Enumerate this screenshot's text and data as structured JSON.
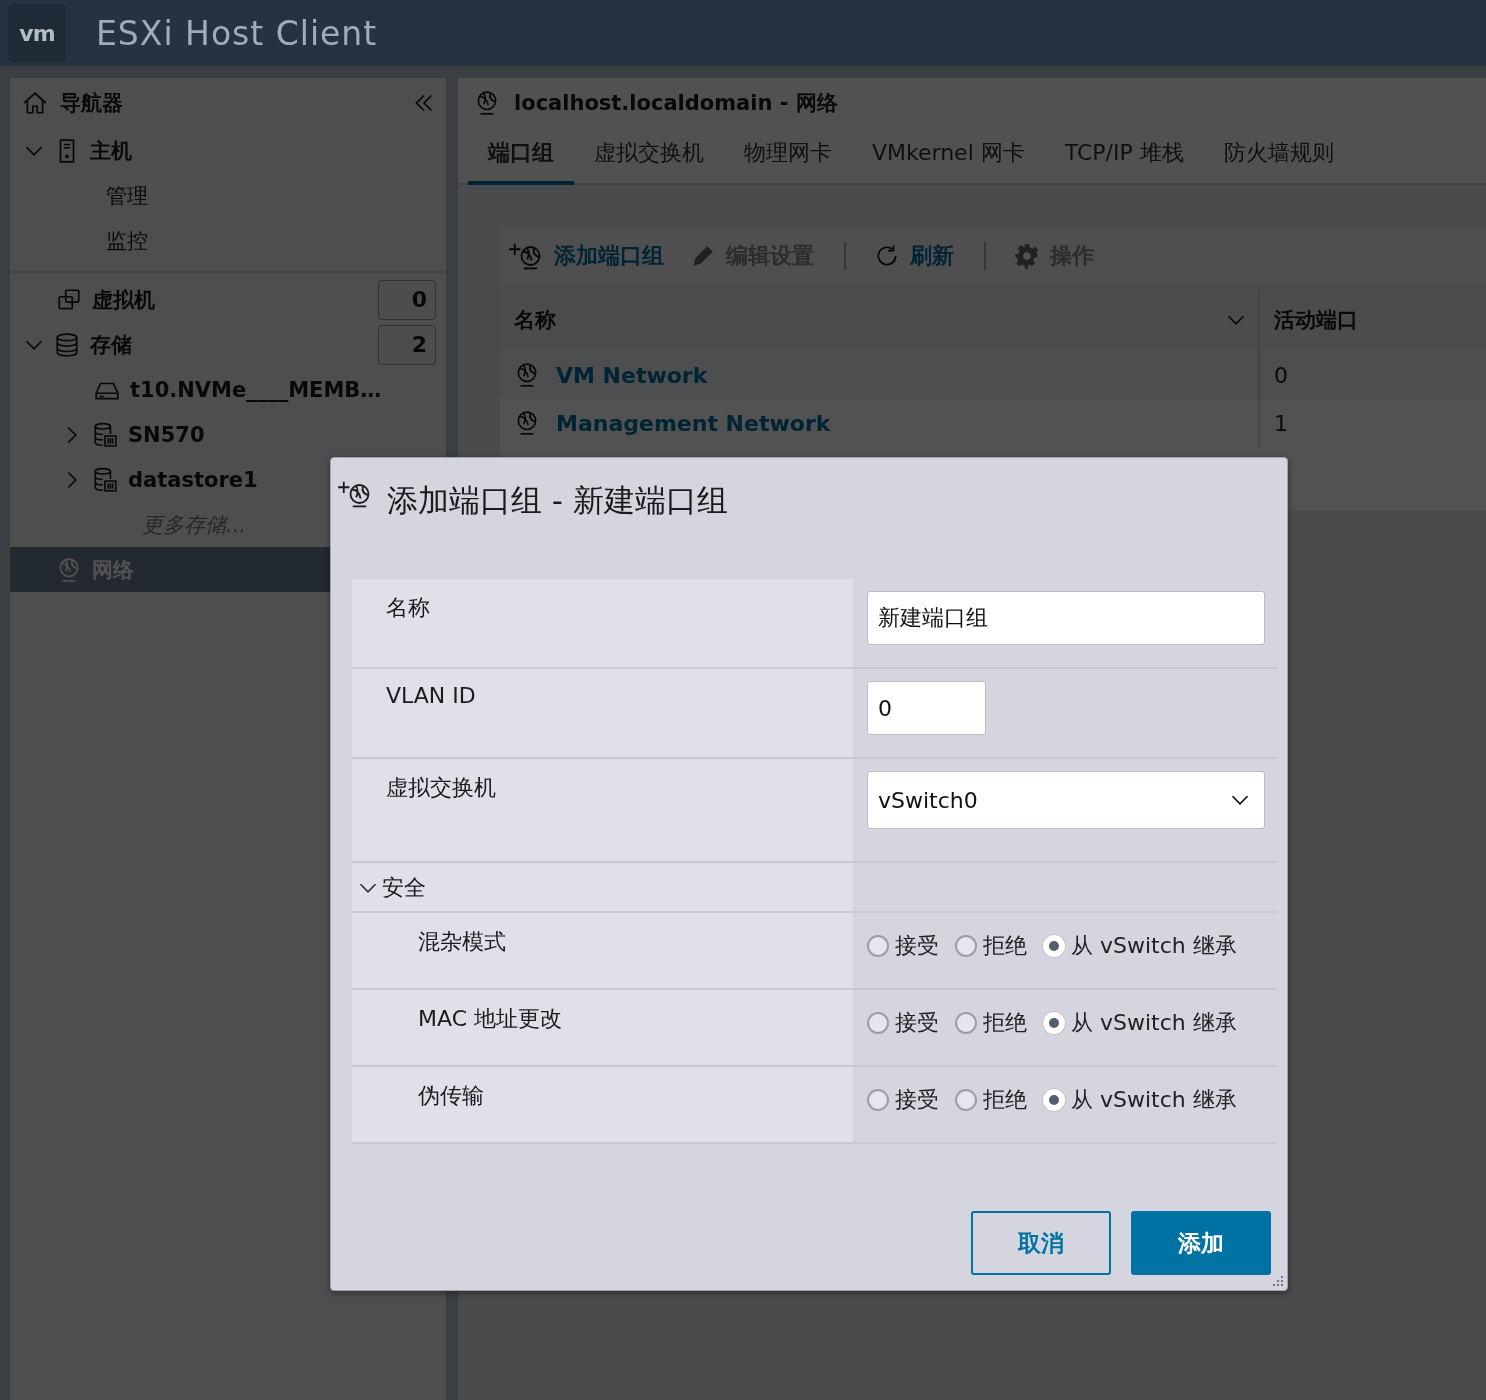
{
  "header": {
    "logo": "vm",
    "title": "ESXi Host Client"
  },
  "navigator": {
    "title": "导航器",
    "items": [
      {
        "label": "主机",
        "kind": "host",
        "expanded": true,
        "selected": false,
        "children": [
          {
            "label": "管理",
            "kind": "page",
            "selected": false
          },
          {
            "label": "监控",
            "kind": "page",
            "selected": false
          }
        ]
      },
      {
        "label": "虚拟机",
        "kind": "vm",
        "count": "0",
        "selected": false
      },
      {
        "label": "存储",
        "kind": "storage",
        "count": "2",
        "expanded": true,
        "selected": false,
        "children": [
          {
            "label": "t10.NVMe____MEMB…",
            "kind": "disk",
            "selected": false
          },
          {
            "label": "SN570",
            "kind": "datastore",
            "expanded": false,
            "selected": false
          },
          {
            "label": "datastore1",
            "kind": "datastore",
            "expanded": false,
            "selected": false
          },
          {
            "label": "更多存储...",
            "kind": "more",
            "selected": false
          }
        ]
      },
      {
        "label": "网络",
        "kind": "network",
        "selected": true
      }
    ]
  },
  "main": {
    "title": "localhost.localdomain - 网络",
    "tabs": [
      {
        "label": "端口组",
        "selected": true
      },
      {
        "label": "虚拟交换机",
        "selected": false
      },
      {
        "label": "物理网卡",
        "selected": false
      },
      {
        "label": "VMkernel 网卡",
        "selected": false
      },
      {
        "label": "TCP/IP 堆栈",
        "selected": false
      },
      {
        "label": "防火墙规则",
        "selected": false
      }
    ],
    "toolbar": [
      {
        "label": "添加端口组",
        "kind": "add",
        "disabled": false
      },
      {
        "label": "编辑设置",
        "kind": "edit",
        "disabled": true
      },
      {
        "label": "刷新",
        "kind": "refresh",
        "disabled": false
      },
      {
        "label": "操作",
        "kind": "actions",
        "disabled": true
      }
    ],
    "table": {
      "columns": [
        "名称",
        "活动端口"
      ],
      "rows": [
        {
          "name": "VM Network",
          "active_ports": "0"
        },
        {
          "name": "Management Network",
          "active_ports": "1"
        }
      ]
    }
  },
  "dialog": {
    "title": "添加端口组 - 新建端口组",
    "fields": [
      {
        "label": "名称",
        "kind": "text",
        "value": "新建端口组"
      },
      {
        "label": "VLAN ID",
        "kind": "number",
        "value": "0"
      },
      {
        "label": "虚拟交换机",
        "kind": "select",
        "value": "vSwitch0"
      }
    ],
    "section": {
      "label": "安全",
      "expanded": true
    },
    "policies": [
      {
        "label": "混杂模式",
        "options": [
          {
            "label": "接受",
            "selected": false
          },
          {
            "label": "拒绝",
            "selected": false
          },
          {
            "label": "从 vSwitch 继承",
            "selected": true
          }
        ]
      },
      {
        "label": "MAC 地址更改",
        "options": [
          {
            "label": "接受",
            "selected": false
          },
          {
            "label": "拒绝",
            "selected": false
          },
          {
            "label": "从 vSwitch 继承",
            "selected": true
          }
        ]
      },
      {
        "label": "伪传输",
        "options": [
          {
            "label": "接受",
            "selected": false
          },
          {
            "label": "拒绝",
            "selected": false
          },
          {
            "label": "从 vSwitch 继承",
            "selected": true
          }
        ]
      }
    ],
    "buttons": [
      {
        "label": "取消",
        "kind": "secondary"
      },
      {
        "label": "添加",
        "kind": "primary"
      }
    ]
  }
}
